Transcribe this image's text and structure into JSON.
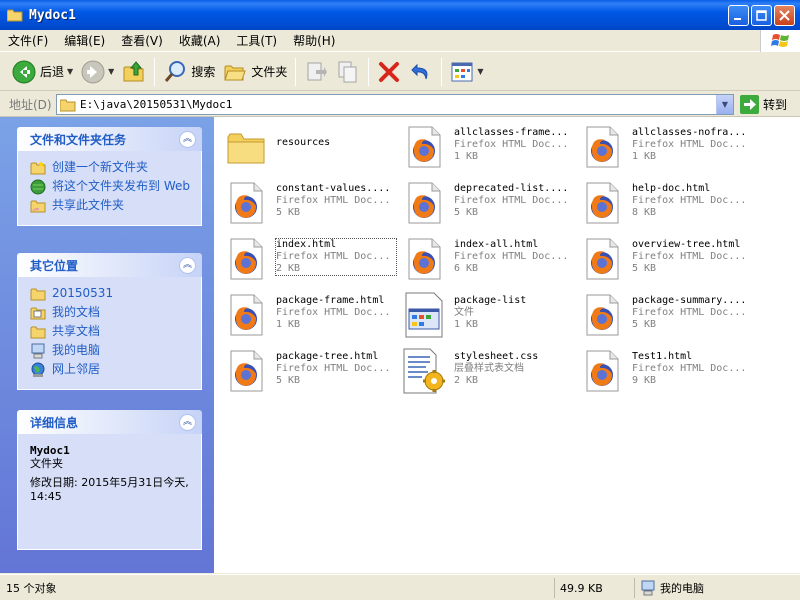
{
  "window": {
    "title": "Mydoc1"
  },
  "menu": [
    "文件(F)",
    "编辑(E)",
    "查看(V)",
    "收藏(A)",
    "工具(T)",
    "帮助(H)"
  ],
  "toolbar": {
    "back": "后退",
    "search": "搜索",
    "folders": "文件夹"
  },
  "address": {
    "label": "地址(D)",
    "path": "E:\\java\\20150531\\Mydoc1",
    "go": "转到"
  },
  "tasks": {
    "title": "文件和文件夹任务",
    "items": [
      "创建一个新文件夹",
      "将这个文件夹发布到 Web",
      "共享此文件夹"
    ]
  },
  "places": {
    "title": "其它位置",
    "items": [
      "20150531",
      "我的文档",
      "共享文档",
      "我的电脑",
      "网上邻居"
    ]
  },
  "details": {
    "title": "详细信息",
    "name": "Mydoc1",
    "type": "文件夹",
    "modified": "修改日期: 2015年5月31日今天, 14:45"
  },
  "files": [
    {
      "name": "resources",
      "type": "",
      "size": "",
      "icon": "folder"
    },
    {
      "name": "allclasses-frame...",
      "type": "Firefox HTML Doc...",
      "size": "1 KB",
      "icon": "firefox"
    },
    {
      "name": "allclasses-nofra...",
      "type": "Firefox HTML Doc...",
      "size": "1 KB",
      "icon": "firefox"
    },
    {
      "name": "constant-values....",
      "type": "Firefox HTML Doc...",
      "size": "5 KB",
      "icon": "firefox"
    },
    {
      "name": "deprecated-list....",
      "type": "Firefox HTML Doc...",
      "size": "5 KB",
      "icon": "firefox"
    },
    {
      "name": "help-doc.html",
      "type": "Firefox HTML Doc...",
      "size": "8 KB",
      "icon": "firefox"
    },
    {
      "name": "index.html",
      "type": "Firefox HTML Doc...",
      "size": "2 KB",
      "icon": "firefox"
    },
    {
      "name": "index-all.html",
      "type": "Firefox HTML Doc...",
      "size": "6 KB",
      "icon": "firefox"
    },
    {
      "name": "overview-tree.html",
      "type": "Firefox HTML Doc...",
      "size": "5 KB",
      "icon": "firefox"
    },
    {
      "name": "package-frame.html",
      "type": "Firefox HTML Doc...",
      "size": "1 KB",
      "icon": "firefox"
    },
    {
      "name": "package-list",
      "type": "文件",
      "size": "1 KB",
      "icon": "generic-file"
    },
    {
      "name": "package-summary....",
      "type": "Firefox HTML Doc...",
      "size": "5 KB",
      "icon": "firefox"
    },
    {
      "name": "package-tree.html",
      "type": "Firefox HTML Doc...",
      "size": "5 KB",
      "icon": "firefox"
    },
    {
      "name": "stylesheet.css",
      "type": "层叠样式表文档",
      "size": "2 KB",
      "icon": "css"
    },
    {
      "name": "Test1.html",
      "type": "Firefox HTML Doc...",
      "size": "9 KB",
      "icon": "firefox"
    }
  ],
  "status": {
    "count": "15 个对象",
    "size": "49.9 KB",
    "location": "我的电脑"
  }
}
